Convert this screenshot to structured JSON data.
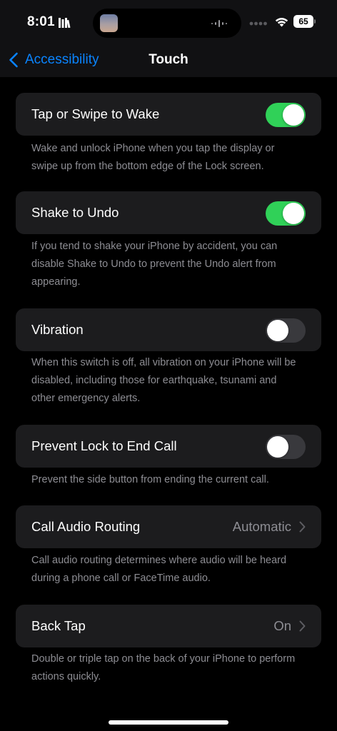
{
  "status_bar": {
    "time": "8:01",
    "battery": "65"
  },
  "nav": {
    "back_label": "Accessibility",
    "title": "Touch"
  },
  "settings": [
    {
      "label": "Tap or Swipe to Wake",
      "type": "toggle",
      "enabled": true,
      "footnote": "Wake and unlock iPhone when you tap the display or swipe up from the bottom edge of the Lock screen."
    },
    {
      "label": "Shake to Undo",
      "type": "toggle",
      "enabled": true,
      "footnote": "If you tend to shake your iPhone by accident, you can disable Shake to Undo to prevent the Undo alert from appearing."
    },
    {
      "label": "Vibration",
      "type": "toggle",
      "enabled": false,
      "footnote": "When this switch is off, all vibration on your iPhone will be disabled, including those for earthquake, tsunami and other emergency alerts."
    },
    {
      "label": "Prevent Lock to End Call",
      "type": "toggle",
      "enabled": false,
      "footnote": "Prevent the side button from ending the current call."
    },
    {
      "label": "Call Audio Routing",
      "type": "link",
      "value": "Automatic",
      "footnote": "Call audio routing determines where audio will be heard during a phone call or FaceTime audio."
    },
    {
      "label": "Back Tap",
      "type": "link",
      "value": "On",
      "footnote": "Double or triple tap on the back of your iPhone to perform actions quickly."
    }
  ],
  "colors": {
    "accent": "#0a84ff",
    "toggle_on": "#30d158",
    "toggle_off": "#39393d",
    "cell_bg": "#1c1c1e",
    "secondary_text": "#8d8d93"
  },
  "icons": {
    "back": "chevron-left-icon",
    "disclosure": "chevron-right-icon",
    "wifi": "wifi-icon",
    "cellular": "cellular-dots-icon",
    "focus": "book-icon",
    "audio": "waveform-icon"
  }
}
